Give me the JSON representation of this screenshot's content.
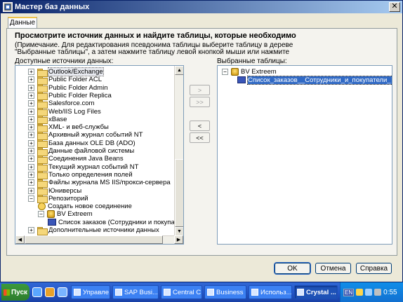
{
  "window": {
    "title": "Мастер баз данных",
    "close_glyph": "✕"
  },
  "tab": {
    "label": "Данные"
  },
  "instructions": {
    "heading": "Просмотрите источник данных и найдите таблицы, которые необходимо",
    "note_line1": "(Примечание. Для редактирования псевдонима таблицы выберите таблицу в дереве",
    "note_line2": "\"Выбранные таблицы\", а затем нажмите таблицу левой кнопкой мыши или нажмите"
  },
  "left_panel": {
    "label": "Доступные источники данных:",
    "items": [
      {
        "label": "Outlook/Exchange",
        "expander": "+",
        "icon": "folder-icon",
        "selected": true
      },
      {
        "label": "Public Folder ACL",
        "expander": "+",
        "icon": "folder-icon"
      },
      {
        "label": "Public Folder Admin",
        "expander": "+",
        "icon": "folder-icon"
      },
      {
        "label": "Public Folder Replica",
        "expander": "+",
        "icon": "folder-icon"
      },
      {
        "label": "Salesforce.com",
        "expander": "+",
        "icon": "folder-icon"
      },
      {
        "label": "Web/IIS Log Files",
        "expander": "+",
        "icon": "folder-icon"
      },
      {
        "label": "xBase",
        "expander": "+",
        "icon": "folder-icon"
      },
      {
        "label": "XML- и веб-службы",
        "expander": "+",
        "icon": "folder-icon"
      },
      {
        "label": "Архивный журнал событий NT",
        "expander": "+",
        "icon": "folder-icon"
      },
      {
        "label": "База данных OLE DB (ADO)",
        "expander": "+",
        "icon": "folder-icon"
      },
      {
        "label": "Данные файловой системы",
        "expander": "+",
        "icon": "folder-icon"
      },
      {
        "label": "Соединения Java Beans",
        "expander": "+",
        "icon": "folder-icon"
      },
      {
        "label": "Текущий журнал событий NT",
        "expander": "+",
        "icon": "folder-icon"
      },
      {
        "label": "Только определения полей",
        "expander": "+",
        "icon": "folder-icon"
      },
      {
        "label": "Файлы журнала MS IIS/прокси-сервера",
        "expander": "+",
        "icon": "folder-icon"
      },
      {
        "label": "Юниверсы",
        "expander": "+",
        "icon": "folder-icon"
      },
      {
        "label": "Репозиторий",
        "expander": "−",
        "icon": "folder-icon"
      },
      {
        "label": "Создать новое соединение",
        "expander": "",
        "icon": "new-connection-icon"
      },
      {
        "label": "BV Extreem",
        "expander": "−",
        "icon": "database-icon"
      },
      {
        "label": "Список заказов (Сотрудники и покупатели)",
        "expander": "",
        "icon": "table-icon"
      },
      {
        "label": "Дополнительные источники данных",
        "expander": "+",
        "icon": "folder-icon"
      }
    ]
  },
  "right_panel": {
    "label": "Выбранные таблицы:",
    "items": [
      {
        "label": "BV Extreem",
        "expander": "−",
        "icon": "database-icon"
      },
      {
        "label": "Список_заказов__Сотрудники_и_покупатели_",
        "icon": "table-icon",
        "selected": true
      }
    ]
  },
  "transfer_buttons": {
    "add": ">",
    "add_all": ">>",
    "remove": "<",
    "remove_all": "<<"
  },
  "dialog_buttons": {
    "ok": "OK",
    "cancel": "Отмена",
    "help": "Справка"
  },
  "taskbar": {
    "start_label": "Пуск",
    "tasks": [
      {
        "label": "Управле...",
        "active": false
      },
      {
        "label": "SAP Busi...",
        "active": false
      },
      {
        "label": "Central C...",
        "active": false
      },
      {
        "label": "Business ...",
        "active": false
      },
      {
        "label": "Использ...",
        "active": false
      },
      {
        "label": "Crystal ...",
        "active": true
      }
    ],
    "language": "EN",
    "clock": "0:55"
  }
}
